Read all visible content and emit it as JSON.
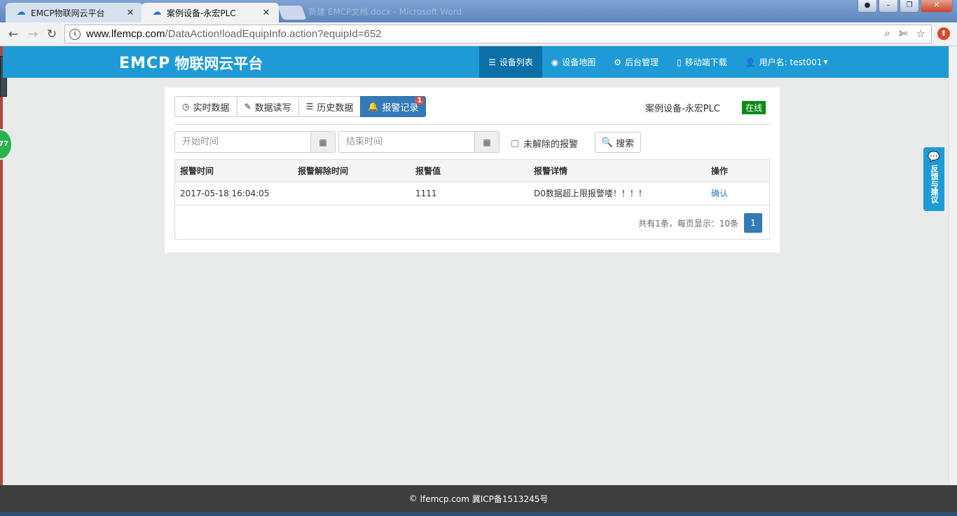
{
  "browser": {
    "tabs": [
      {
        "title": "EMCP物联网云平台",
        "icon": "cloud-icon",
        "active": false
      },
      {
        "title": "案例设备-永宏PLC",
        "icon": "cloud-icon",
        "active": true
      }
    ],
    "ghost_tab_title": "新建 EMCP文档.docx - Microsoft Word",
    "url_host": "www.lfemcp.com",
    "url_path": "/DataAction!loadEquipInfo.action?equipId=652"
  },
  "navbar": {
    "logo_mark": "EMCP",
    "logo_text": "物联网云平台",
    "items": [
      {
        "label": "设备列表",
        "icon": "list-icon",
        "active": true
      },
      {
        "label": "设备地图",
        "icon": "globe-icon",
        "active": false
      },
      {
        "label": "后台管理",
        "icon": "gears-icon",
        "active": false
      },
      {
        "label": "移动端下载",
        "icon": "mobile-icon",
        "active": false
      },
      {
        "label": "用户名: test001",
        "icon": "user-icon",
        "active": false
      }
    ]
  },
  "device": {
    "tabs": [
      {
        "label": "实时数据",
        "icon": "clock-icon"
      },
      {
        "label": "数据读写",
        "icon": "pencil-icon"
      },
      {
        "label": "历史数据",
        "icon": "list-icon"
      },
      {
        "label": "报警记录",
        "icon": "bell-icon",
        "badge": "1"
      }
    ],
    "name": "案例设备-永宏PLC",
    "status": "在线",
    "status_color": "#0a8a18"
  },
  "filters": {
    "start_placeholder": "开始时间",
    "end_placeholder": "结束时间",
    "unresolved_label": "未解除的报警",
    "search_label": "搜索"
  },
  "alarm_table": {
    "headers": [
      "报警时间",
      "报警解除时间",
      "报警值",
      "报警详情",
      "操作"
    ],
    "rows": [
      {
        "time": "2017-05-18 16:04:05",
        "resolved_time": "",
        "value": "1111",
        "detail": "D0数据超上限报警喽！！！！",
        "action": "确认"
      }
    ],
    "pager_info": "共有1条，每页显示：10条",
    "current_page": "1"
  },
  "side_widgets": {
    "feedback_label": "反馈与建议",
    "float_badge": "77"
  },
  "footer": {
    "text": "lfemcp.com 冀ICP备1513245号"
  },
  "colors": {
    "navbar": "#1e9bd6",
    "navbar_active": "#0b6fa8",
    "primary": "#337ab7",
    "footer": "#3e3e3e"
  }
}
